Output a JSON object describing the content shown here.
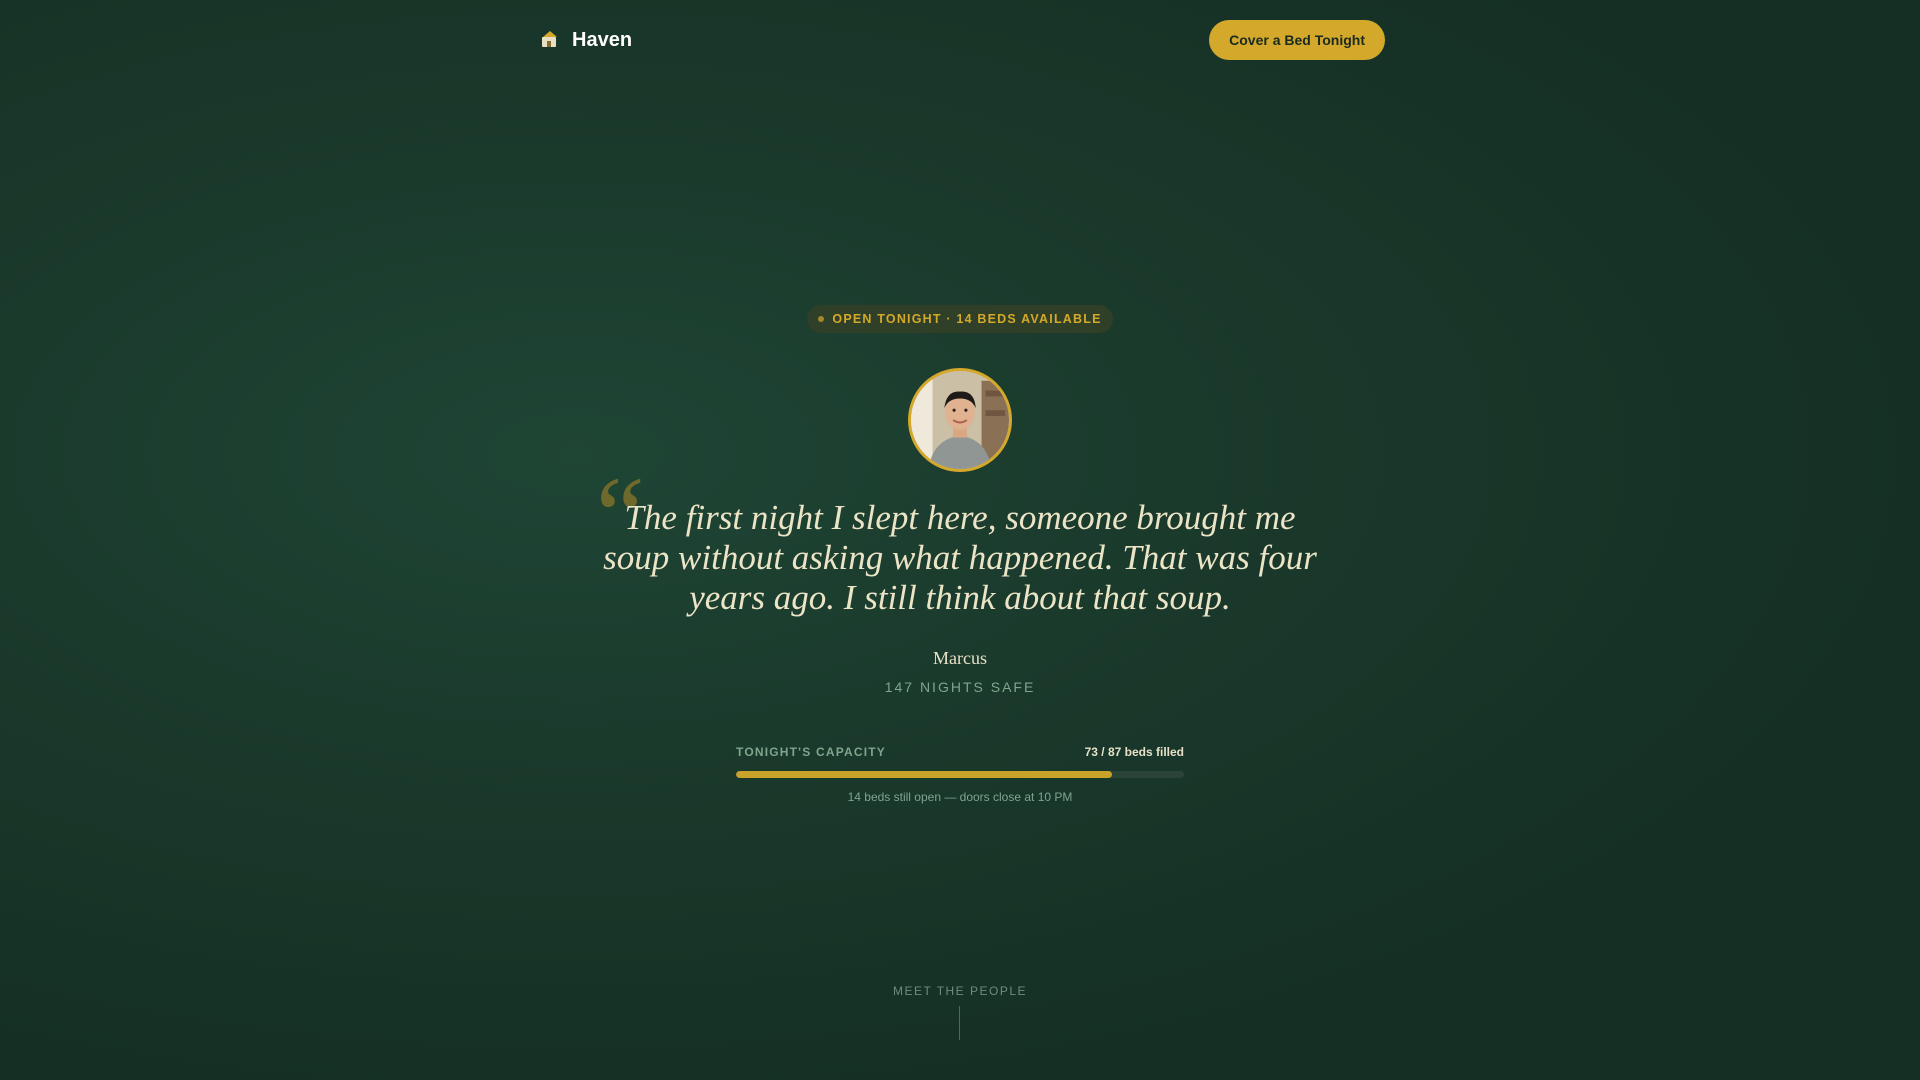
{
  "header": {
    "brand_name": "Haven",
    "brand_icon": "house-icon",
    "cta_label": "Cover a Bed Tonight"
  },
  "status": {
    "text": "OPEN TONIGHT · 14 BEDS AVAILABLE"
  },
  "testimonial": {
    "quote": "The first night I slept here, someone brought me soup without asking what happened. That was four years ago. I still think about that soup.",
    "quote_mark": "“",
    "name": "Marcus",
    "stat": "147 NIGHTS SAFE"
  },
  "capacity": {
    "label": "TONIGHT'S CAPACITY",
    "count_text": "73 / 87 beds filled",
    "filled": 73,
    "total": 87,
    "note": "14 beds still open — doors close at 10 PM"
  },
  "footer": {
    "label": "MEET THE PEOPLE"
  },
  "colors": {
    "accent": "#d4a82a",
    "background": "#1a3a2c",
    "muted_text": "#7fa58e"
  }
}
